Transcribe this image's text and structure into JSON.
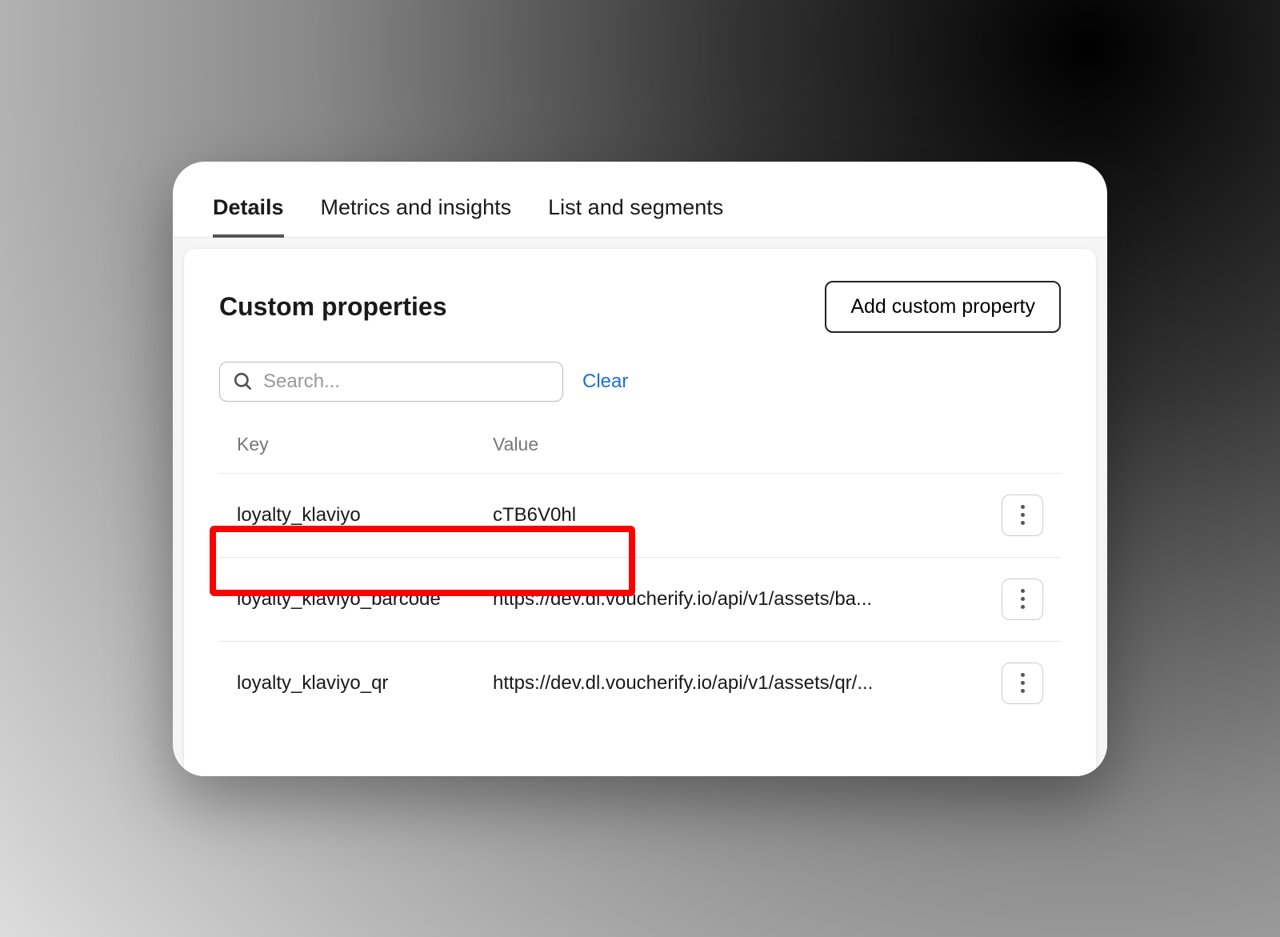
{
  "tabs": [
    {
      "label": "Details",
      "active": true
    },
    {
      "label": "Metrics and insights",
      "active": false
    },
    {
      "label": "List and segments",
      "active": false
    }
  ],
  "panel": {
    "title": "Custom properties",
    "add_button": "Add custom property"
  },
  "search": {
    "placeholder": "Search...",
    "clear": "Clear"
  },
  "table": {
    "headers": {
      "key": "Key",
      "value": "Value"
    },
    "rows": [
      {
        "key": "loyalty_klaviyo",
        "value": "cTB6V0hl"
      },
      {
        "key": "loyalty_klaviyo_barcode",
        "value": "https://dev.dl.voucherify.io/api/v1/assets/ba..."
      },
      {
        "key": "loyalty_klaviyo_qr",
        "value": "https://dev.dl.voucherify.io/api/v1/assets/qr/..."
      }
    ]
  }
}
